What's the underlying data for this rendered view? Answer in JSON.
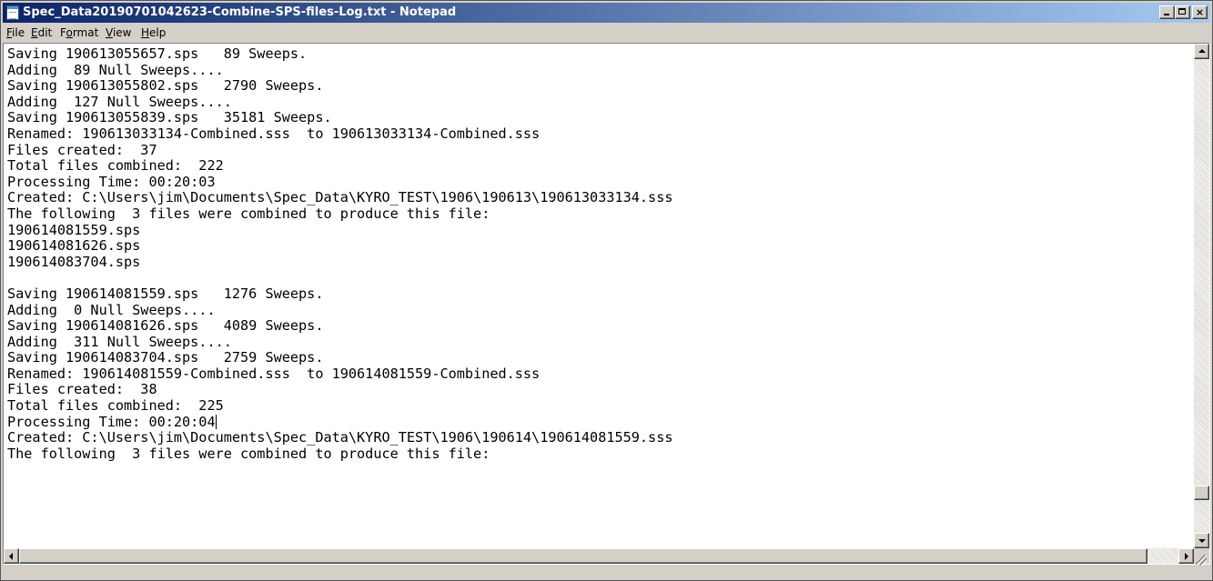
{
  "window": {
    "title": "Spec_Data20190701042623-Combine-SPS-files-Log.txt - Notepad"
  },
  "controls": {
    "minimize": "_",
    "maximize": "□",
    "close": "×"
  },
  "menu": [
    {
      "hotkey": "F",
      "rest": "ile"
    },
    {
      "hotkey": "E",
      "rest": "dit"
    },
    {
      "pre": "F",
      "hotkey": "o",
      "rest": "rmat"
    },
    {
      "hotkey": "V",
      "rest": "iew"
    },
    {
      "hotkey": "H",
      "rest": "elp"
    }
  ],
  "editor": {
    "lines": [
      "Saving 190613055657.sps   89 Sweeps.",
      "Adding  89 Null Sweeps....",
      "Saving 190613055802.sps   2790 Sweeps.",
      "Adding  127 Null Sweeps....",
      "Saving 190613055839.sps   35181 Sweeps.",
      "Renamed: 190613033134-Combined.sss  to 190613033134-Combined.sss",
      "Files created:  37",
      "Total files combined:  222",
      "Processing Time: 00:20:03",
      "Created: C:\\Users\\jim\\Documents\\Spec_Data\\KYRO_TEST\\1906\\190613\\190613033134.sss",
      "The following  3 files were combined to produce this file:",
      "190614081559.sps",
      "190614081626.sps",
      "190614083704.sps",
      "",
      "Saving 190614081559.sps   1276 Sweeps.",
      "Adding  0 Null Sweeps....",
      "Saving 190614081626.sps   4089 Sweeps.",
      "Adding  311 Null Sweeps....",
      "Saving 190614083704.sps   2759 Sweeps.",
      "Renamed: 190614081559-Combined.sss  to 190614081559-Combined.sss",
      "Files created:  38",
      "Total files combined:  225",
      "Processing Time: 00:20:04",
      "Created: C:\\Users\\jim\\Documents\\Spec_Data\\KYRO_TEST\\1906\\190614\\190614081559.sss",
      "The following  3 files were combined to produce this file:"
    ],
    "caret_line_index": 23
  }
}
